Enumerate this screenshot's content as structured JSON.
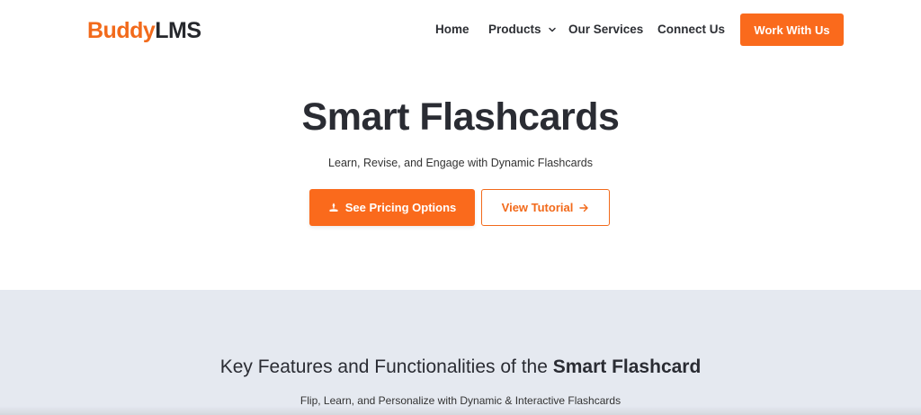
{
  "brand": {
    "part1": "Buddy",
    "part2": "LMS"
  },
  "nav": {
    "home": "Home",
    "products": "Products",
    "services": "Our Services",
    "connect": "Connect Us",
    "cta": "Work With Us"
  },
  "hero": {
    "title": "Smart Flashcards",
    "subtitle": "Learn, Revise, and Engage with Dynamic Flashcards",
    "primary_button": "See Pricing Options",
    "secondary_button": "View Tutorial"
  },
  "features": {
    "title_regular": "Key Features and Functionalities of the ",
    "title_bold": "Smart Flashcard",
    "subtitle": "Flip, Learn, and Personalize with Dynamic & Interactive Flashcards"
  },
  "colors": {
    "accent": "#fa6a1c",
    "section_bg": "#e5e9f0",
    "text": "#2a2c33"
  },
  "icons": {
    "products_dropdown": "chevron-down-icon",
    "pricing": "pricing-tag-icon",
    "tutorial": "arrow-right-icon"
  }
}
